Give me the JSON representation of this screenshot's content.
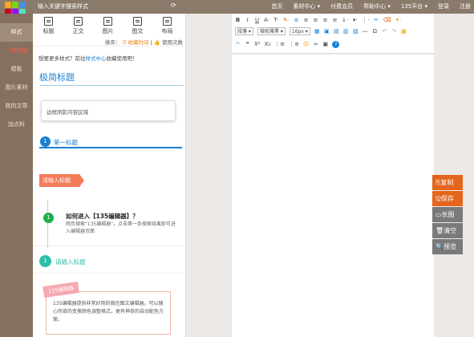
{
  "topbar": {
    "search_placeholder": "输入关键字搜索样式",
    "nav": [
      "首页",
      "素材中心 ▾",
      "付费会员",
      "帮助中心 ▾",
      "135平台 ▾",
      "登录",
      "注册"
    ]
  },
  "rail": {
    "items": [
      {
        "label": "样式",
        "state": "active"
      },
      {
        "label": "一键排版",
        "state": "hot"
      },
      {
        "label": "模板",
        "state": ""
      },
      {
        "label": "图片素材",
        "state": ""
      },
      {
        "label": "我的文章",
        "state": ""
      },
      {
        "label": "加点料",
        "state": ""
      }
    ]
  },
  "panel": {
    "categories": [
      "标题",
      "正文",
      "图片",
      "图文",
      "布局"
    ],
    "sort_label": "排序：",
    "sort_active": "收藏时间",
    "sort_other": "使用次数",
    "notice_prefix": "想要更多样式？前往",
    "notice_link": "样式中心",
    "notice_suffix": "收藏使用吧！",
    "simple_title": "极简标题",
    "shadow_box": "边框阴影内容区域",
    "num_title": {
      "num": "1",
      "text": "第一标题"
    },
    "ribbon_title": "请输入标题",
    "faq": {
      "num": "1",
      "question": "如何进入【135编辑器】？",
      "answer": "网页搜索\"135编辑器\"，点击第一条搜索结果即可进入编辑器页面"
    },
    "green_title": {
      "num": "1",
      "text": "请输入标题"
    },
    "card": {
      "tag": "135编辑器",
      "text": "135编辑器提供非常好用的微信图文编辑器。可以随心所欲的变换颜色调整格式，更有神奇的自动配色方案。"
    }
  },
  "toolbar": {
    "row1": [
      "B",
      "I",
      "U",
      "A·",
      "T·",
      "✎·",
      "≡",
      "≡",
      "≡",
      "≡",
      "≡",
      "↓·",
      "▾·",
      "⋮·",
      "✂",
      "⌫",
      "✦·"
    ],
    "row2_paragraph": "段落",
    "row2_font": "微软雅黑",
    "row2_size": "16px",
    "row3": [
      "ʳᵉ",
      "❝",
      "X²",
      "X₂",
      "⋮≡",
      "⋮≡",
      "☺",
      "∞",
      "▣",
      "?"
    ]
  },
  "actions": [
    {
      "label": "复制",
      "icon": "copy-icon",
      "style": "orange"
    },
    {
      "label": "保存",
      "icon": "save-icon",
      "style": "orange"
    },
    {
      "label": "长图",
      "icon": "image-icon",
      "style": "gray"
    },
    {
      "label": "清空",
      "icon": "trash-icon",
      "style": "gray"
    },
    {
      "label": "预览",
      "icon": "search-icon",
      "style": "gray"
    }
  ],
  "colors": {
    "rail": "#857060",
    "accent_blue": "#1a7fd0",
    "orange": "#e4661c",
    "coral": "#f47c5a",
    "teal": "#2dbfa8"
  }
}
